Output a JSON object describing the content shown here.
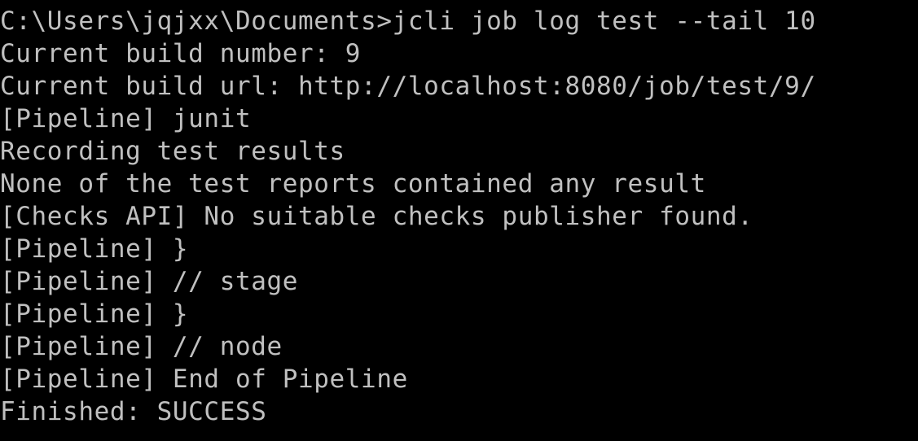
{
  "terminal": {
    "background": "#000000",
    "foreground": "#c0c0c0",
    "lines": [
      "C:\\Users\\jqjxx\\Documents>jcli job log test --tail 10",
      "Current build number: 9",
      "Current build url: http://localhost:8080/job/test/9/",
      "[Pipeline] junit",
      "Recording test results",
      "None of the test reports contained any result",
      "[Checks API] No suitable checks publisher found.",
      "[Pipeline] }",
      "[Pipeline] // stage",
      "[Pipeline] }",
      "[Pipeline] // node",
      "[Pipeline] End of Pipeline",
      "Finished: SUCCESS"
    ]
  }
}
